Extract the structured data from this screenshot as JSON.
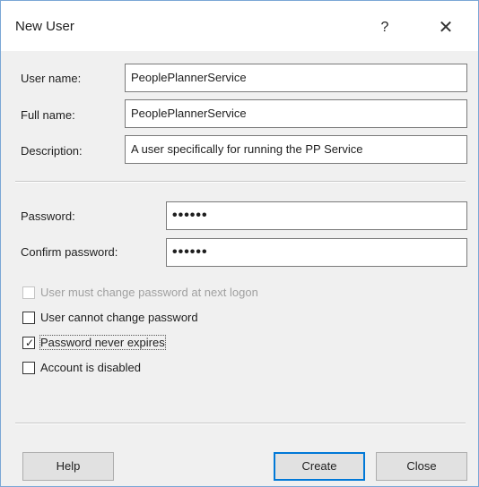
{
  "window": {
    "title": "New User",
    "help_glyph": "?",
    "close_glyph": "✕"
  },
  "fields": {
    "username": {
      "label": "User name:",
      "value": "PeoplePlannerService"
    },
    "fullname": {
      "label": "Full name:",
      "value": "PeoplePlannerService"
    },
    "description": {
      "label": "Description:",
      "value": "A user specifically for running the PP Service"
    },
    "password": {
      "label": "Password:",
      "value": "••••••"
    },
    "confirm_password": {
      "label": "Confirm password:",
      "value": "••••••"
    }
  },
  "options": {
    "must_change": {
      "label": "User must change password at next logon",
      "checked": false,
      "enabled": false
    },
    "cannot_change": {
      "label": "User cannot change password",
      "checked": false,
      "enabled": true
    },
    "never_expires": {
      "label": "Password never expires",
      "checked": true,
      "enabled": true
    },
    "disabled": {
      "label": "Account is disabled",
      "checked": false,
      "enabled": true
    }
  },
  "buttons": {
    "help": "Help",
    "create": "Create",
    "close": "Close"
  },
  "colors": {
    "dialog_bg": "#f0f0f0",
    "accent": "#0078d7",
    "disabled_text": "#a0a0a0"
  },
  "icons": {
    "help": "question-mark-icon",
    "close": "close-icon",
    "check": "checkmark-icon"
  }
}
